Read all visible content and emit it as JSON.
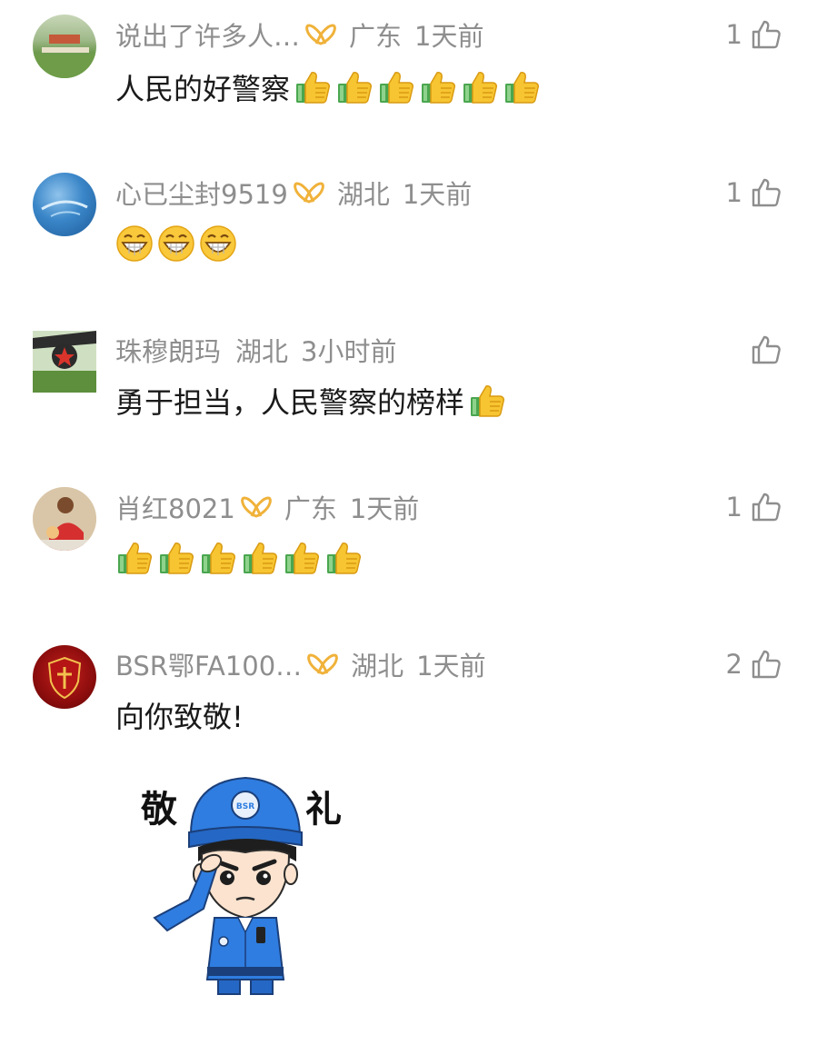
{
  "comments": [
    {
      "username": "说出了许多人…",
      "location": "广东",
      "time": "1天前",
      "likes": "1",
      "text": "人民的好警察",
      "emoji_count": 6,
      "emoji_type": "thumbs-up",
      "avatar": "landscape-avatar"
    },
    {
      "username": "心已尘封9519",
      "location": "湖北",
      "time": "1天前",
      "likes": "1",
      "text": "",
      "emoji_count": 3,
      "emoji_type": "grin-face",
      "avatar": "blue-avatar"
    },
    {
      "username": "珠穆朗玛",
      "location": "湖北",
      "time": "3小时前",
      "likes": "",
      "text": "勇于担当，人民警察的榜样",
      "emoji_count": 1,
      "emoji_type": "thumbs-up",
      "avatar": "star-avatar"
    },
    {
      "username": "肖红8021",
      "location": "广东",
      "time": "1天前",
      "likes": "1",
      "text": "",
      "emoji_count": 6,
      "emoji_type": "thumbs-up",
      "avatar": "person-avatar"
    },
    {
      "username": "BSR鄂FA100…",
      "location": "湖北",
      "time": "1天前",
      "likes": "2",
      "text": "向你致敬!",
      "emoji_count": 0,
      "emoji_type": "",
      "avatar": "red-badge-avatar"
    }
  ],
  "sticker": {
    "left_word": "敬",
    "right_word": "礼",
    "cap_badge": "BSR"
  },
  "colors": {
    "meta_text": "#8e8e8e",
    "body_text": "#1a1a1a",
    "badge_orange": "#f0b23a",
    "police_blue": "#2f7de0"
  }
}
